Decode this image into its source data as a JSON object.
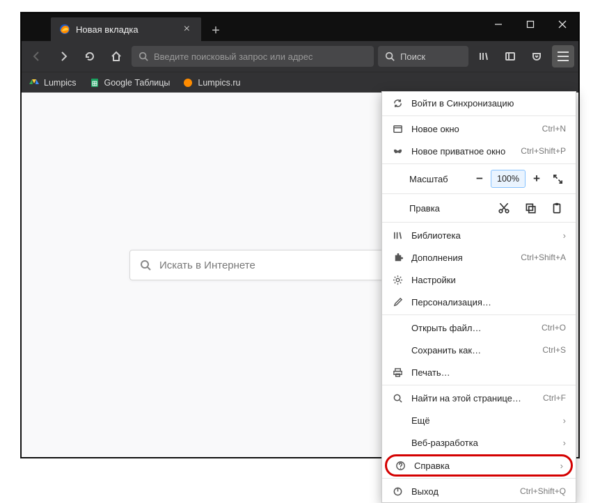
{
  "tab": {
    "title": "Новая вкладка"
  },
  "urlbar": {
    "placeholder": "Введите поисковый запрос или адрес"
  },
  "searchbar": {
    "placeholder": "Поиск"
  },
  "bookmarks": [
    {
      "label": "Lumpics"
    },
    {
      "label": "Google Таблицы"
    },
    {
      "label": "Lumpics.ru"
    }
  ],
  "content_search": {
    "placeholder": "Искать в Интернете"
  },
  "menu": {
    "sign_in": "Войти в Синхронизацию",
    "new_window": {
      "label": "Новое окно",
      "shortcut": "Ctrl+N"
    },
    "new_private": {
      "label": "Новое приватное окно",
      "shortcut": "Ctrl+Shift+P"
    },
    "zoom": {
      "label": "Масштаб",
      "value": "100%"
    },
    "edit": {
      "label": "Правка"
    },
    "library": "Библиотека",
    "addons": {
      "label": "Дополнения",
      "shortcut": "Ctrl+Shift+A"
    },
    "settings": "Настройки",
    "customize": "Персонализация…",
    "open_file": {
      "label": "Открыть файл…",
      "shortcut": "Ctrl+O"
    },
    "save_as": {
      "label": "Сохранить как…",
      "shortcut": "Ctrl+S"
    },
    "print": "Печать…",
    "find": {
      "label": "Найти на этой странице…",
      "shortcut": "Ctrl+F"
    },
    "more": "Ещё",
    "webdev": "Веб-разработка",
    "help": "Справка",
    "exit": {
      "label": "Выход",
      "shortcut": "Ctrl+Shift+Q"
    }
  }
}
